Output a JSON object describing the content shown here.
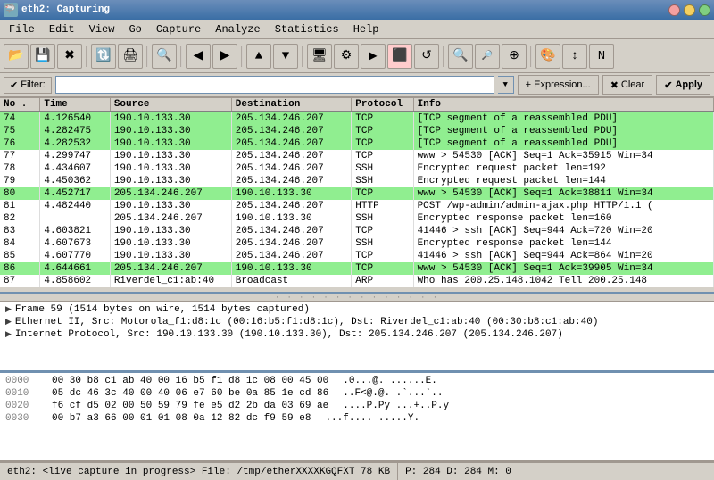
{
  "titleBar": {
    "title": "eth2: Capturing",
    "icon": "🦈"
  },
  "menuBar": {
    "items": [
      "File",
      "Edit",
      "View",
      "Go",
      "Capture",
      "Analyze",
      "Statistics",
      "Help"
    ]
  },
  "toolbar": {
    "buttons": [
      {
        "name": "open-capture",
        "icon": "📁"
      },
      {
        "name": "save-capture",
        "icon": "💾"
      },
      {
        "name": "close-capture",
        "icon": "✖"
      },
      {
        "name": "reload-capture",
        "icon": "🔄"
      },
      {
        "name": "capture-options",
        "icon": "⚙"
      },
      {
        "name": "start-capture",
        "icon": "▶"
      },
      {
        "name": "stop-capture",
        "icon": "⬛"
      },
      {
        "name": "restart-capture",
        "icon": "↺"
      },
      {
        "name": "capture-filter",
        "icon": "🔍"
      },
      {
        "name": "zoom-in",
        "icon": "+"
      },
      {
        "name": "zoom-out",
        "icon": "-"
      },
      {
        "name": "zoom-reset",
        "icon": "="
      },
      {
        "name": "scroll-to-begin",
        "icon": "⏮"
      },
      {
        "name": "scroll-to-end",
        "icon": "⏭"
      },
      {
        "name": "back",
        "icon": "◀"
      },
      {
        "name": "forward",
        "icon": "▶"
      },
      {
        "name": "go-to-packet",
        "icon": "↗"
      },
      {
        "name": "find-packet",
        "icon": "🔍"
      },
      {
        "name": "find-next",
        "icon": "⬇"
      },
      {
        "name": "find-prev",
        "icon": "⬆"
      },
      {
        "name": "mark-packet",
        "icon": "✔"
      },
      {
        "name": "toggle-name-resolution",
        "icon": "N"
      },
      {
        "name": "colorize",
        "icon": "🎨"
      },
      {
        "name": "auto-scroll",
        "icon": "↕"
      },
      {
        "name": "zoom-100",
        "icon": "⊕"
      }
    ]
  },
  "filterBar": {
    "label": "Filter:",
    "checkmark": "✔",
    "inputValue": "",
    "inputPlaceholder": "",
    "expressionLabel": "+ Expression...",
    "clearLabel": "✖ Clear",
    "applyLabel": "✔ Apply"
  },
  "packetList": {
    "columns": [
      "No .",
      "Time",
      "Source",
      "Destination",
      "Protocol",
      "Info"
    ],
    "rows": [
      {
        "no": "74",
        "time": "4.126540",
        "src": "190.10.133.30",
        "dst": "205.134.246.207",
        "proto": "TCP",
        "info": "[TCP segment of a reassembled PDU]",
        "color": "green"
      },
      {
        "no": "75",
        "time": "4.282475",
        "src": "190.10.133.30",
        "dst": "205.134.246.207",
        "proto": "TCP",
        "info": "[TCP segment of a reassembled PDU]",
        "color": "green"
      },
      {
        "no": "76",
        "time": "4.282532",
        "src": "190.10.133.30",
        "dst": "205.134.246.207",
        "proto": "TCP",
        "info": "[TCP segment of a reassembled PDU]",
        "color": "green"
      },
      {
        "no": "77",
        "time": "4.299747",
        "src": "190.10.133.30",
        "dst": "205.134.246.207",
        "proto": "TCP",
        "info": "www > 54530 [ACK] Seq=1 Ack=35915 Win=34",
        "color": "white"
      },
      {
        "no": "78",
        "time": "4.434607",
        "src": "190.10.133.30",
        "dst": "205.134.246.207",
        "proto": "SSH",
        "info": "Encrypted request packet len=192",
        "color": "white"
      },
      {
        "no": "79",
        "time": "4.450362",
        "src": "190.10.133.30",
        "dst": "205.134.246.207",
        "proto": "SSH",
        "info": "Encrypted request packet len=144",
        "color": "white"
      },
      {
        "no": "80",
        "time": "4.452717",
        "src": "205.134.246.207",
        "dst": "190.10.133.30",
        "proto": "TCP",
        "info": "www > 54530 [ACK] Seq=1 Ack=38811 Win=34",
        "color": "green"
      },
      {
        "no": "81",
        "time": "4.482440",
        "src": "190.10.133.30",
        "dst": "205.134.246.207",
        "proto": "HTTP",
        "info": "POST /wp-admin/admin-ajax.php HTTP/1.1 (",
        "color": "white"
      },
      {
        "no": "82",
        "time": "",
        "src": "205.134.246.207",
        "dst": "190.10.133.30",
        "proto": "SSH",
        "info": "Encrypted response packet len=160",
        "color": "white"
      },
      {
        "no": "83",
        "time": "4.603821",
        "src": "190.10.133.30",
        "dst": "205.134.246.207",
        "proto": "TCP",
        "info": "41446 > ssh [ACK] Seq=944 Ack=720 Win=20",
        "color": "white"
      },
      {
        "no": "84",
        "time": "4.607673",
        "src": "190.10.133.30",
        "dst": "205.134.246.207",
        "proto": "SSH",
        "info": "Encrypted response packet len=144",
        "color": "white"
      },
      {
        "no": "85",
        "time": "4.607770",
        "src": "190.10.133.30",
        "dst": "205.134.246.207",
        "proto": "TCP",
        "info": "41446 > ssh [ACK] Seq=944 Ack=864 Win=20",
        "color": "white"
      },
      {
        "no": "86",
        "time": "4.644661",
        "src": "205.134.246.207",
        "dst": "190.10.133.30",
        "proto": "TCP",
        "info": "www > 54530 [ACK] Seq=1 Ack=39905 Win=34",
        "color": "green"
      },
      {
        "no": "87",
        "time": "4.858602",
        "src": "Riverdel_c1:ab:40",
        "dst": "Broadcast",
        "proto": "ARP",
        "info": "Who has 200.25.148.1042  Tell 200.25.148",
        "color": "white"
      }
    ]
  },
  "detailPane": {
    "items": [
      {
        "text": "Frame 59 (1514 bytes on wire, 1514 bytes captured)"
      },
      {
        "text": "Ethernet II, Src: Motorola_f1:d8:1c (00:16:b5:f1:d8:1c), Dst: Riverdel_c1:ab:40 (00:30:b8:c1:ab:40)"
      },
      {
        "text": "Internet Protocol, Src: 190.10.133.30 (190.10.133.30), Dst: 205.134.246.207 (205.134.246.207)"
      }
    ]
  },
  "hexPane": {
    "rows": [
      {
        "offset": "0000",
        "hex": "00 30 b8 c1 ab 40 00 16  b5 f1 d8 1c 08 00 45 00",
        "ascii": ".0...@. ......E."
      },
      {
        "offset": "0010",
        "hex": "05 dc 46 3c 40 00 40 06  e7 60 be 0a 85 1e cd 86",
        "ascii": "..F<@.@. .`...`.."
      },
      {
        "offset": "0020",
        "hex": "f6 cf d5 02 00 50 59 79  fe e5 d2 2b da 03 69 ae",
        "ascii": "....P.Py ...+..P.y"
      },
      {
        "offset": "0030",
        "hex": "00 b7 a3 66 00 01 01 08  0a 12 82 dc f9 59 e8",
        "ascii": "...f.... .....Y."
      }
    ]
  },
  "statusBar": {
    "left": "eth2: <live capture in progress> File: /tmp/etherXXXXKGQFXT 78 KB",
    "middle": "P: 284 D: 284 M: 0",
    "right": ""
  },
  "colors": {
    "green_row": "#90ee90",
    "selected_row": "#3a6ea5",
    "white_row": "#ffffff",
    "header_bg": "#d4d0c8"
  }
}
